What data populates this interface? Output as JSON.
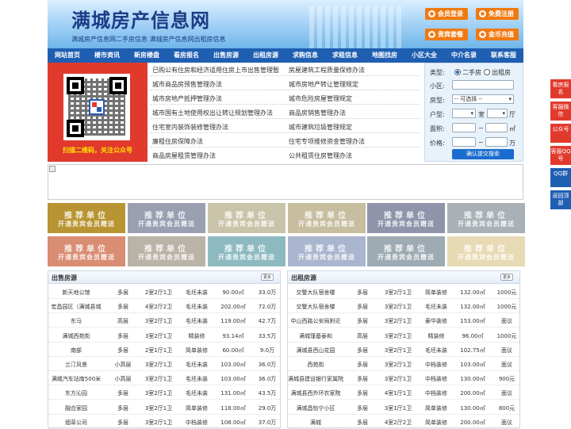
{
  "header": {
    "title": "满城房产信息网",
    "subtitle": "满城房产信息网二手房信息    满城房产信息网出租房信息",
    "buttons": [
      {
        "label": "会员登录",
        "icon": "user-icon"
      },
      {
        "label": "免费注册",
        "icon": "register-icon"
      },
      {
        "label": "贵宾套餐",
        "icon": "vip-icon"
      },
      {
        "label": "金币充值",
        "icon": "coin-icon"
      }
    ]
  },
  "nav": [
    "网站首页",
    "楼市资讯",
    "新房楼盘",
    "看房报名",
    "出售房源",
    "出租房源",
    "求购信息",
    "求租信息",
    "地图找房",
    "小区大全",
    "中介名录",
    "联系客服"
  ],
  "qr": {
    "caption": "扫描二维码，关注公众号"
  },
  "links": {
    "left": [
      "已购公有住房和经济适用住房上市出售管理暂",
      "城市商品房预售管理办法",
      "城市房地产抵押管理办法",
      "城市国有土地使用权出让转让规划管理办法",
      "住宅室内装饰装修管理办法",
      "廉租住房保障办法",
      "商品房屋租赁管理办法"
    ],
    "right": [
      "房屋建筑工程质量保修办法",
      "城市房地产转让管理规定",
      "城市危险房屋管理规定",
      "商品房销售管理办法",
      "城市建筑垃圾管理规定",
      "住宅专项维修资金管理办法",
      "公共租赁住房管理办法"
    ]
  },
  "search": {
    "type_label": "类型:",
    "type_options": [
      "二手房",
      "出租房"
    ],
    "community_label": "小区:",
    "house_label": "房型:",
    "house_select": "-- 可选择 --",
    "layout_label": "户型:",
    "layout_room_unit": "室",
    "layout_hall_unit": "厅",
    "area_label": "面积:",
    "area_unit": "㎡",
    "price_label": "价格:",
    "price_unit": "万",
    "tilde": "~",
    "submit_label": "确认提交搜索"
  },
  "promo": {
    "line1": "推荐单位",
    "line2": "开通贵宾会员赠送",
    "colors": [
      "#b89532",
      "#9a9fb2",
      "#c9c3a9",
      "#c7bd9f",
      "#8f94aa",
      "#a9b1b6",
      "#d98d73",
      "#b9b3a8",
      "#8dbac0",
      "#aab6cf",
      "#9eabb3",
      "#e7dab4"
    ]
  },
  "sale": {
    "title": "出售房源",
    "more": "更多",
    "rows": [
      [
        "新天地公馆",
        "多层",
        "2室2厅1卫",
        "毛坯未装",
        "90.00㎡",
        "33.0万"
      ],
      [
        "宏昌园区（满城县城",
        "多层",
        "4室2厅2卫",
        "毛坯未装",
        "202.00㎡",
        "72.0万"
      ],
      [
        "东马",
        "高层",
        "3室2厅1卫",
        "毛坯未装",
        "119.00㎡",
        "42.7万"
      ],
      [
        "满城西苑街",
        "多层",
        "3室2厅1卫",
        "精装修",
        "93.14㎡",
        "33.5万"
      ],
      [
        "南部",
        "多层",
        "2室1厅1卫",
        "简单装修",
        "60.00㎡",
        "9.0万"
      ],
      [
        "兰汀风景",
        "小高层",
        "3室2厅1卫",
        "毛坯未装",
        "103.00㎡",
        "36.0万"
      ],
      [
        "满城汽车站南500米",
        "小高层",
        "3室2厅1卫",
        "毛坯未装",
        "103.00㎡",
        "36.0万"
      ],
      [
        "东方沁园",
        "多层",
        "3室2厅1卫",
        "毛坯未装",
        "131.00㎡",
        "43.5万"
      ],
      [
        "融合家园",
        "多层",
        "3室2厅1卫",
        "简单装修",
        "118.00㎡",
        "29.0万"
      ],
      [
        "烟草公司",
        "多层",
        "3室2厅1卫",
        "中档装修",
        "108.00㎡",
        "37.0万"
      ]
    ]
  },
  "rent": {
    "title": "出租房源",
    "more": "更多",
    "rows": [
      [
        "交警大队宿舍楼",
        "多层",
        "3室2厅1卫",
        "简单装修",
        "132.00㎡",
        "1000元"
      ],
      [
        "交警大队宿舍楼",
        "多层",
        "3室2厅1卫",
        "毛坯未装",
        "132.00㎡",
        "1000元"
      ],
      [
        "中山西路公安局附近",
        "多层",
        "3室2厅1卫",
        "豪华装修",
        "153.00㎡",
        "面议"
      ],
      [
        "满城瑾基泰和",
        "高层",
        "3室2厅1卫",
        "精装修",
        "96.00㎡",
        "1000元"
      ],
      [
        "满城县西山花园",
        "多层",
        "3室2厅1卫",
        "毛坯未装",
        "102.75㎡",
        "面议"
      ],
      [
        "西苑街",
        "多层",
        "3室2厅1卫",
        "中档装修",
        "103.00㎡",
        "面议"
      ],
      [
        "满城县建设银行家属院",
        "多层",
        "3室2厅1卫",
        "中档装修",
        "130.00㎡",
        "900元"
      ],
      [
        "满城县西外环农家院",
        "多层",
        "4室1厅1卫",
        "中档装修",
        "200.00㎡",
        "面议"
      ],
      [
        "满城昌怡宁小区",
        "多层",
        "3室1厅1卫",
        "简单装修",
        "130.00㎡",
        "800元"
      ],
      [
        "满城",
        "多层",
        "4室2厅2卫",
        "简单装修",
        "200.00㎡",
        "面议"
      ]
    ]
  },
  "sidebar": [
    "看房报名",
    "客服微信",
    "公众号",
    "客服QQ号",
    "QQ群",
    "返回顶部"
  ]
}
